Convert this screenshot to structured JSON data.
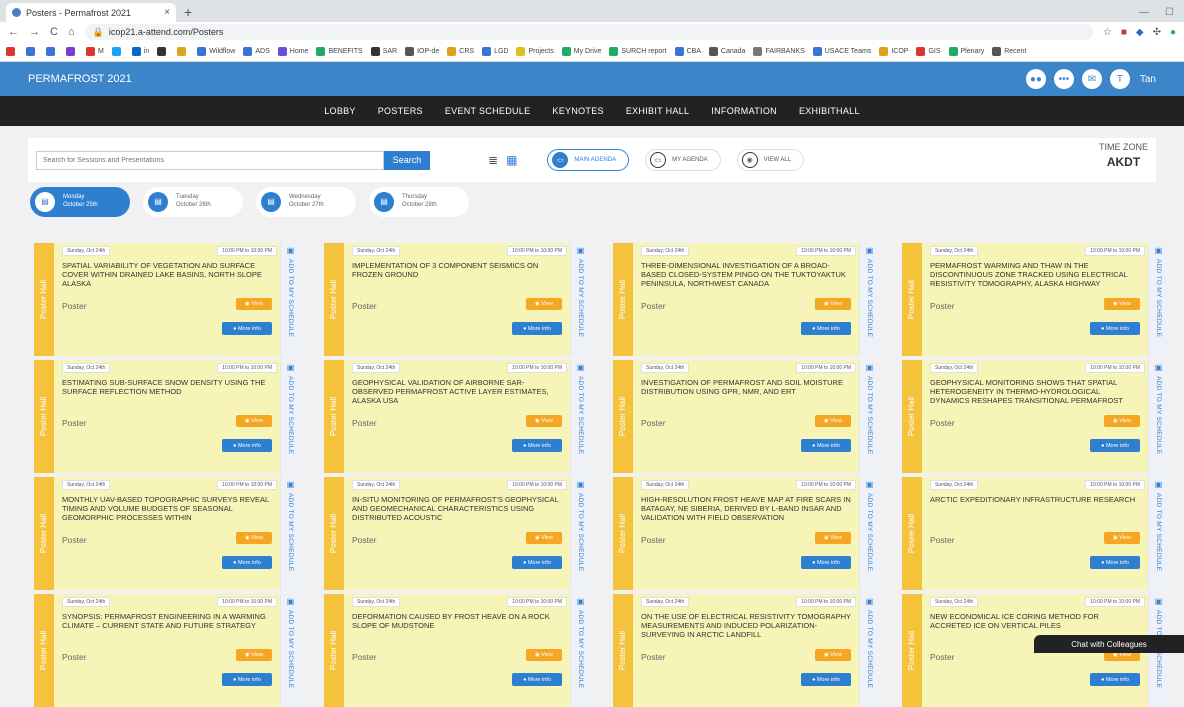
{
  "browser": {
    "tab_title": "Posters - Permafrost 2021",
    "tab_close": "×",
    "new_tab": "+",
    "url": "icop21.a-attend.com/Posters",
    "back": "←",
    "forward": "→",
    "reload": "C",
    "home": "⌂",
    "bookmarks": [
      {
        "label": "",
        "color": "#d33"
      },
      {
        "label": "",
        "color": "#3b73d6"
      },
      {
        "label": "",
        "color": "#3b73d6"
      },
      {
        "label": "",
        "color": "#7c3ad6"
      },
      {
        "label": "M",
        "color": "#d33"
      },
      {
        "label": "",
        "color": "#1da1f2"
      },
      {
        "label": "in",
        "color": "#0a66c2"
      },
      {
        "label": "",
        "color": "#333"
      },
      {
        "label": "",
        "color": "#e0a020"
      },
      {
        "label": "Wildflow",
        "color": "#3b73d6"
      },
      {
        "label": "ADS",
        "color": "#3b73d6"
      },
      {
        "label": "Home",
        "color": "#6b4fd6"
      },
      {
        "label": "BENEFITS",
        "color": "#2a6"
      },
      {
        "label": "SAR",
        "color": "#333"
      },
      {
        "label": "IOP-de",
        "color": "#555"
      },
      {
        "label": "CRS",
        "color": "#e0a020"
      },
      {
        "label": "LGD",
        "color": "#3b73d6"
      },
      {
        "label": "Projects",
        "color": "#e0c020"
      },
      {
        "label": "My Drive",
        "color": "#2a6"
      },
      {
        "label": "SURCH report",
        "color": "#2a6"
      },
      {
        "label": "CBA",
        "color": "#3b73d6"
      },
      {
        "label": "Canada",
        "color": "#555"
      },
      {
        "label": "FAIRBANKS",
        "color": "#777"
      },
      {
        "label": "USACE Teams",
        "color": "#3b73d6"
      },
      {
        "label": "ICOP",
        "color": "#e0a020"
      },
      {
        "label": "GIS",
        "color": "#d33"
      },
      {
        "label": "Plenary",
        "color": "#2a6"
      },
      {
        "label": "Recent",
        "color": "#555"
      }
    ]
  },
  "site": {
    "title": "PERMAFROST 2021",
    "user_initial": "T",
    "user_name": "Tan"
  },
  "nav": [
    "LOBBY",
    "POSTERS",
    "EVENT SCHEDULE",
    "KEYNOTES",
    "EXHIBIT HALL",
    "INFORMATION",
    "EXHIBITHALL"
  ],
  "toolbar": {
    "search_placeholder": "Search for Sessions and Presentations",
    "search_button": "Search",
    "list_view": "≣",
    "grid_view": "▦",
    "main_agenda": "MAIN AGENDA",
    "my_agenda": "MY AGENDA",
    "view_all": "VIEW ALL",
    "timezone_label": "TIME ZONE",
    "timezone_value": "AKDT"
  },
  "days": [
    {
      "day": "Monday",
      "date": "October 25th",
      "active": true
    },
    {
      "day": "Tuesday",
      "date": "October 26th",
      "active": false
    },
    {
      "day": "Wednesday",
      "date": "October 27th",
      "active": false
    },
    {
      "day": "Thursday",
      "date": "October 28th",
      "active": false
    }
  ],
  "card_labels": {
    "strip": "Poster Hall",
    "type": "Poster",
    "view": "View",
    "more": "More info",
    "add": "ADD TO MY SCHEDULE"
  },
  "cards": [
    {
      "date": "Sunday, Oct 24th",
      "time": "10:00 PM to 10:00 PM",
      "title": "SPATIAL VARIABILITY OF VEGETATION AND SURFACE COVER WITHIN DRAINED LAKE BASINS, NORTH SLOPE ALASKA"
    },
    {
      "date": "Sunday, Oct 24th",
      "time": "10:00 PM to 10:00 PM",
      "title": "IMPLEMENTATION OF 3 COMPONENT SEISMICS ON FROZEN GROUND"
    },
    {
      "date": "Sunday, Oct 24th",
      "time": "10:00 PM to 10:00 PM",
      "title": "THREE-DIMENSIONAL INVESTIGATION OF A BROAD-BASED CLOSED-SYSTEM PINGO ON THE TUKTOYAKTUK PENINSULA, NORTHWEST CANADA"
    },
    {
      "date": "Sunday, Oct 24th",
      "time": "10:00 PM to 10:00 PM",
      "title": "PERMAFROST WARMING AND THAW IN THE DISCONTINUOUS ZONE TRACKED USING ELECTRICAL RESISTIVITY TOMOGRAPHY, ALASKA HIGHWAY"
    },
    {
      "date": "Sunday, Oct 24th",
      "time": "10:00 PM to 10:00 PM",
      "title": "ESTIMATING SUB-SURFACE SNOW DENSITY USING THE SURFACE REFLECTION METHOD"
    },
    {
      "date": "Sunday, Oct 24th",
      "time": "10:00 PM to 10:00 PM",
      "title": "GEOPHYSICAL VALIDATION OF AIRBORNE SAR-OBSERVED PERMAFROST ACTIVE LAYER ESTIMATES, ALASKA USA"
    },
    {
      "date": "Sunday, Oct 24th",
      "time": "10:00 PM to 10:00 PM",
      "title": "INVESTIGATION OF PERMAFROST AND SOIL MOISTURE DISTRIBUTION USING GPR, NMR, AND ERT"
    },
    {
      "date": "Sunday, Oct 24th",
      "time": "10:00 PM to 10:00 PM",
      "title": "GEOPHYSICAL MONITORING SHOWS THAT SPATIAL HETEROGENEITY IN THERMO-HYDROLOGICAL DYNAMICS RESHAPES TRANSITIONAL PERMAFROST"
    },
    {
      "date": "Sunday, Oct 24th",
      "time": "10:00 PM to 10:00 PM",
      "title": "MONTHLY UAV-BASED TOPOGRAPHIC SURVEYS REVEAL TIMING AND VOLUME BUDGETS OF SEASONAL GEOMORPHIC PROCESSES WITHIN"
    },
    {
      "date": "Sunday, Oct 24th",
      "time": "10:00 PM to 10:00 PM",
      "title": "IN-SITU MONITORING OF PERMAFROST'S GEOPHYSICAL AND GEOMECHANICAL CHARACTERISTICS USING DISTRIBUTED ACOUSTIC"
    },
    {
      "date": "Sunday, Oct 24th",
      "time": "10:00 PM to 10:00 PM",
      "title": "HIGH-RESOLUTION FROST HEAVE MAP AT FIRE SCARS IN BATAGAY, NE SIBERIA, DERIVED BY L-BAND INSAR AND VALIDATION WITH FIELD OBSERVATION"
    },
    {
      "date": "Sunday, Oct 24th",
      "time": "10:00 PM to 10:00 PM",
      "title": "ARCTIC EXPEDITIONARY INFRASTRUCTURE RESEARCH"
    },
    {
      "date": "Sunday, Oct 24th",
      "time": "10:00 PM to 10:00 PM",
      "title": "SYNOPSIS: PERMAFROST ENGINEERING IN A WARMING CLIMATE – CURRENT STATE AND FUTURE STRATEGY"
    },
    {
      "date": "Sunday, Oct 24th",
      "time": "10:00 PM to 10:00 PM",
      "title": "DEFORMATION CAUSED BY FROST HEAVE ON A ROCK SLOPE OF MUDSTONE"
    },
    {
      "date": "Sunday, Oct 24th",
      "time": "10:00 PM to 10:00 PM",
      "title": "ON THE USE OF ELECTRICAL RESISTIVITY TOMOGRAPHY MEASUREMENTS AND INDUCED POLARIZATION-SURVEYING IN ARCTIC LANDFILL"
    },
    {
      "date": "Sunday, Oct 24th",
      "time": "10:00 PM to 10:00 PM",
      "title": "NEW ECONOMICAL ICE CORING METHOD FOR ACCRETED ICE ON VERTICAL PILES"
    }
  ],
  "chat": "Chat with Colleagues"
}
